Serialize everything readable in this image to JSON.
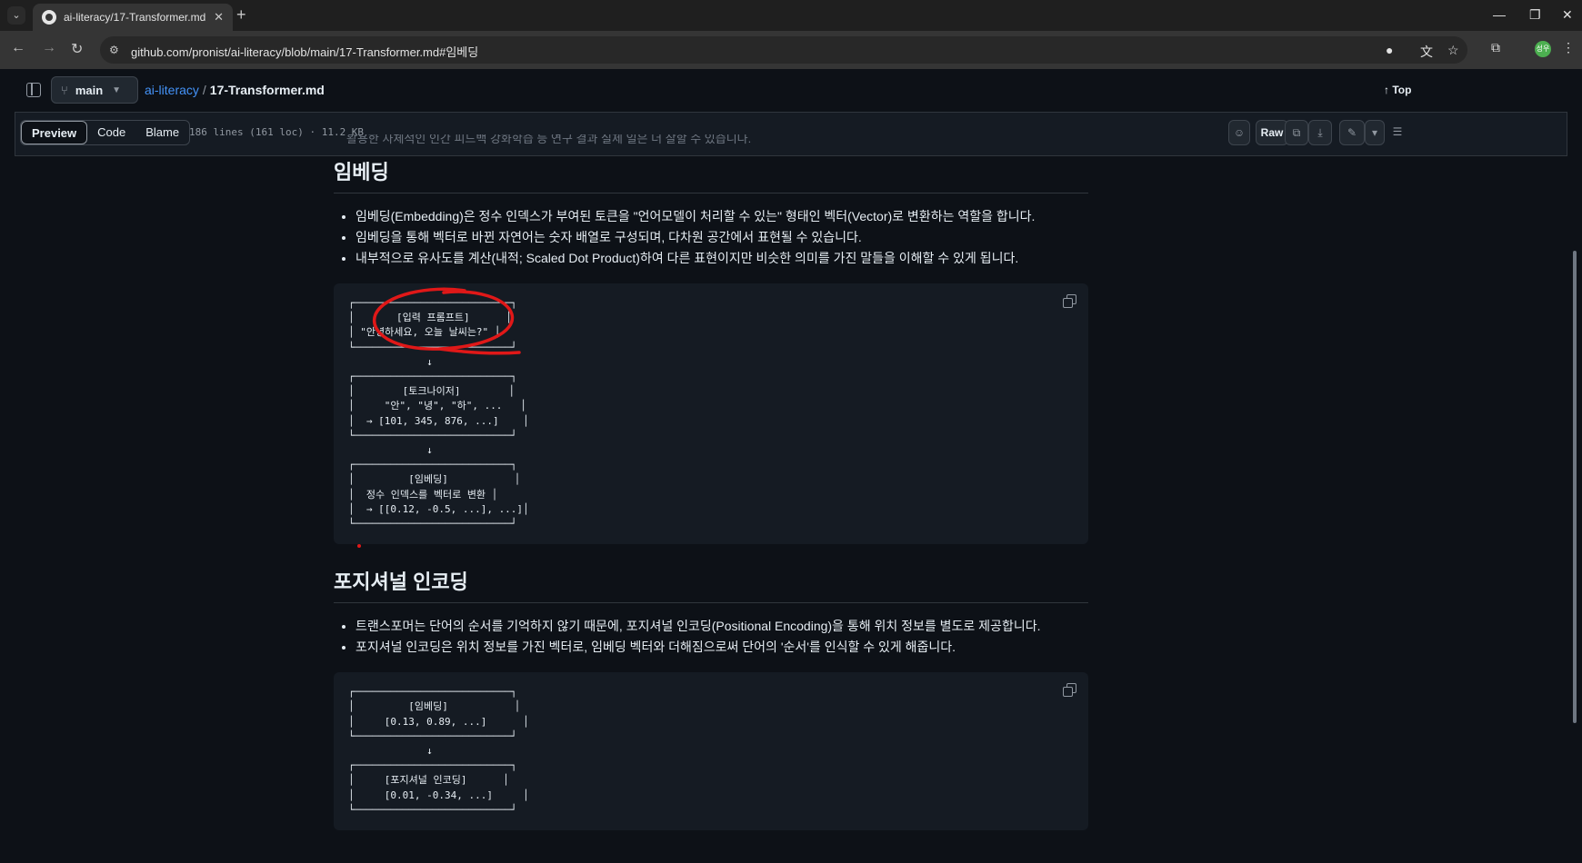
{
  "browser": {
    "tab_title": "ai-literacy/17-Transformer.md",
    "url": "github.com/pronist/ai-literacy/blob/main/17-Transformer.md#임베딩",
    "avatar_text": "성우"
  },
  "repo": {
    "branch": "main",
    "repo_name": "ai-literacy",
    "separator": "/",
    "file_name": "17-Transformer.md",
    "top_label": "Top"
  },
  "file_toolbar": {
    "tabs": [
      "Preview",
      "Code",
      "Blame"
    ],
    "active_tab": "Preview",
    "info": "186 lines (161 loc) · 11.2 KB",
    "raw_label": "Raw"
  },
  "content": {
    "cut_line": "활용한 자체적인 인간 피드백 강화학습 등 연구 결과 실제 일은 더 잘할 수 있습니다.",
    "section1": {
      "heading": "임베딩",
      "bullets": [
        "임베딩(Embedding)은 정수 인덱스가 부여된 토큰을 \"언어모델이 처리할 수 있는\" 형태인 벡터(Vector)로 변환하는 역할을 합니다.",
        "임베딩을 통해 벡터로 바뀐 자연어는 숫자 배열로 구성되며, 다차원 공간에서 표현될 수 있습니다.",
        "내부적으로 유사도를 계산(내적; Scaled Dot Product)하여 다른 표현이지만 비슷한 의미를 가진 말들을 이해할 수 있게 됩니다."
      ],
      "code": "┌──────────────────────────┐\n│       [입력 프롬프트]      │\n│ \"안녕하세요, 오늘 날씨는?\" │\n└──────────────────────────┘\n             ↓\n┌──────────────────────────┐\n│        [토크나이저]        │\n│     \"안\", \"녕\", \"하\", ...   │\n│  → [101, 345, 876, ...]    │\n└──────────────────────────┘\n             ↓\n┌──────────────────────────┐\n│         [임베딩]           │\n│  정수 인덱스를 벡터로 변환 │\n│  → [[0.12, -0.5, ...], ...]│\n└──────────────────────────┘"
    },
    "section2": {
      "heading": "포지셔널 인코딩",
      "bullets": [
        "트랜스포머는 단어의 순서를 기억하지 않기 때문에, 포지셔널 인코딩(Positional Encoding)을 통해 위치 정보를 별도로 제공합니다.",
        "포지셔널 인코딩은 위치 정보를 가진 벡터로, 임베딩 벡터와 더해짐으로써 단어의 '순서'를 인식할 수 있게 해줍니다."
      ],
      "code": "┌──────────────────────────┐\n│         [임베딩]           │\n│     [0.13, 0.89, ...]      │\n└──────────────────────────┘\n             ↓\n┌──────────────────────────┐\n│     [포지셔널 인코딩]      │\n│     [0.01, -0.34, ...]     │\n└──────────────────────────┘"
    }
  },
  "colors": {
    "accent_link": "#4493f8",
    "annotation_red": "#e01818",
    "code_bg": "#151b23"
  }
}
